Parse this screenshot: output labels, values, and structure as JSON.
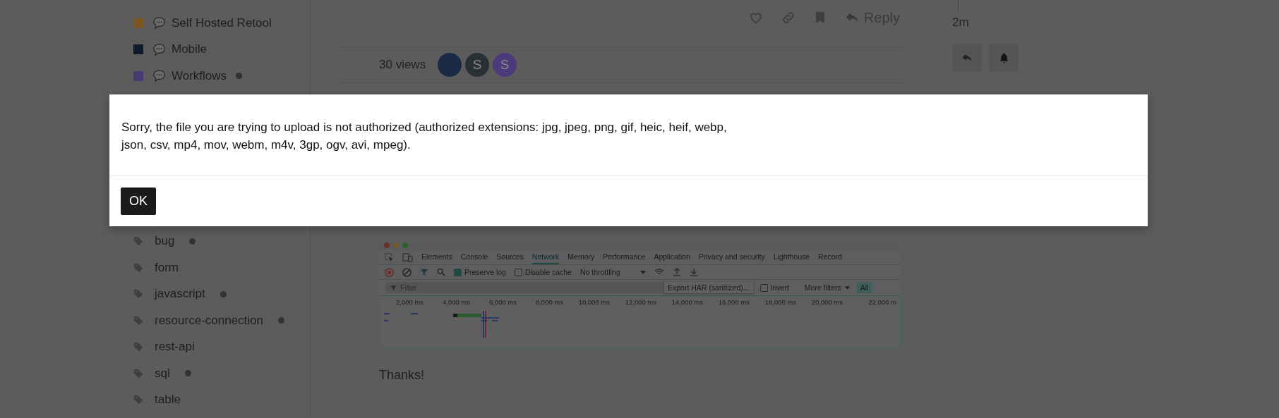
{
  "sidebar": {
    "categories": [
      {
        "label": "Self Hosted Retool",
        "color": "#7c5620",
        "unread": false
      },
      {
        "label": "Mobile",
        "color": "#0e1a2e",
        "unread": false
      },
      {
        "label": "Workflows",
        "color": "#4a3870",
        "unread": true
      }
    ],
    "tags": [
      {
        "label": "bug",
        "unread": true
      },
      {
        "label": "form",
        "unread": false
      },
      {
        "label": "javascript",
        "unread": true
      },
      {
        "label": "resource-connection",
        "unread": true
      },
      {
        "label": "rest-api",
        "unread": false
      },
      {
        "label": "sql",
        "unread": true
      },
      {
        "label": "table",
        "unread": false
      }
    ]
  },
  "post": {
    "reply_label": "Reply",
    "views": "30 views",
    "avatars": [
      {
        "kind": "photo"
      },
      {
        "kind": "letter",
        "letter": "S",
        "color": "#2a3135"
      },
      {
        "kind": "letter",
        "letter": "S",
        "color": "#4b3a7c"
      }
    ],
    "devtools": {
      "tabs": [
        {
          "label": "Elements",
          "selected": false
        },
        {
          "label": "Console",
          "selected": false
        },
        {
          "label": "Sources",
          "selected": false
        },
        {
          "label": "Network",
          "selected": true
        },
        {
          "label": "Memory",
          "selected": false
        },
        {
          "label": "Performance",
          "selected": false
        },
        {
          "label": "Application",
          "selected": false
        },
        {
          "label": "Privacy and security",
          "selected": false
        },
        {
          "label": "Lighthouse",
          "selected": false
        },
        {
          "label": "Record",
          "selected": false
        }
      ],
      "preserve_log": {
        "label": "Preserve log",
        "checked": true
      },
      "disable_cache": {
        "label": "Disable cache",
        "checked": false
      },
      "throttling": "No throttling",
      "filter_placeholder": "Filter",
      "tooltip": "Export HAR (sanitized)...",
      "invert": {
        "label": "Invert",
        "checked": false
      },
      "more_filters": "More filters",
      "all_button": "All",
      "ticks": [
        "2,000 ms",
        "4,000 ms",
        "6,000 ms",
        "8,000 ms",
        "10,000 ms",
        "12,000 ms",
        "14,000 ms",
        "16,000 ms",
        "18,000 ms",
        "20,000 ms",
        "22,000 m"
      ]
    },
    "closing": "Thanks!"
  },
  "timeline": {
    "age": "2m"
  },
  "dialog": {
    "message": "Sorry, the file you are trying to upload is not authorized (authorized extensions: jpg, jpeg, png, gif, heic, heif, webp, json, csv, mp4, mov, webm, m4v, 3gp, ogv, avi, mpeg).",
    "button": "OK"
  }
}
